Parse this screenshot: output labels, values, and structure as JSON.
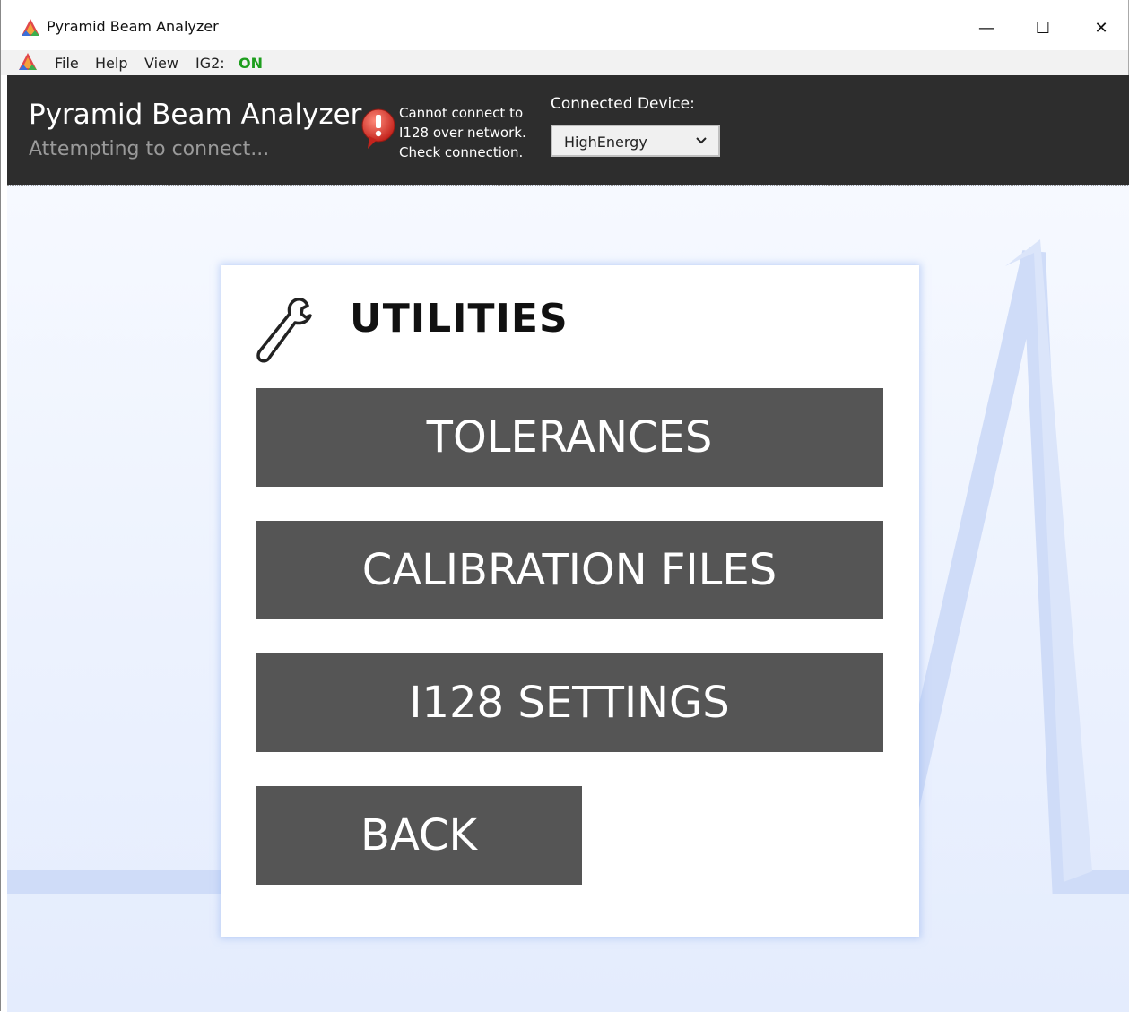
{
  "window": {
    "title": "Pyramid Beam Analyzer",
    "controls": {
      "minimize": "—",
      "maximize": "☐",
      "close": "✕"
    }
  },
  "menu": {
    "items": [
      "File",
      "Help",
      "View",
      "IG2:"
    ],
    "ig2_status": "ON",
    "ig2_status_color": "#1e9e1e"
  },
  "header": {
    "app_name": "Pyramid Beam Analyzer",
    "status": "Attempting to connect...",
    "warning_lines": [
      "Cannot connect to",
      "I128 over network.",
      "Check connection."
    ],
    "warning_icon": "error-bubble-icon",
    "device_label": "Connected Device:",
    "device_value": "HighEnergy"
  },
  "utilities": {
    "title": "UTILITIES",
    "icon": "wrench-icon",
    "buttons": {
      "tolerances": "TOLERANCES",
      "calibration_files": "CALIBRATION FILES",
      "i128_settings": "I128 SETTINGS",
      "back": "BACK"
    }
  },
  "colors": {
    "header_bg": "#2d2d2d",
    "button_bg": "#555555",
    "warning_red": "#e0413a"
  }
}
